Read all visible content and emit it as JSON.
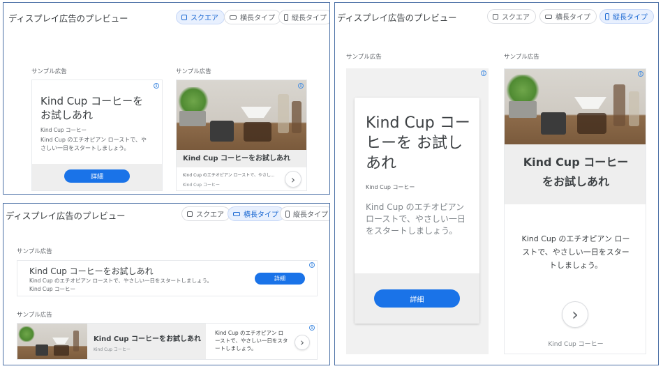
{
  "panel_title": "ディスプレイ広告のプレビュー",
  "tabs": {
    "square": "スクエア",
    "landscape": "横長タイプ",
    "portrait": "縦長タイプ"
  },
  "sample_label": "サンプル広告",
  "ad": {
    "headline": "Kind Cup コーヒーを お試しあれ",
    "headline_plain": "Kind Cup コーヒーをお試しあれ",
    "brand": "Kind Cup コーヒー",
    "description": "Kind Cup のエチオピアン ローストで、やさしい一日をスタートしましょう。",
    "description_short": "Kind Cup のエチオピアン ローストで、やさし...",
    "button": "詳細",
    "info": "i",
    "chevron": "›"
  },
  "colors": {
    "accent": "#1a73e8",
    "active_tab_bg": "#e8f0fe",
    "panel_border": "#4a6fa5"
  }
}
